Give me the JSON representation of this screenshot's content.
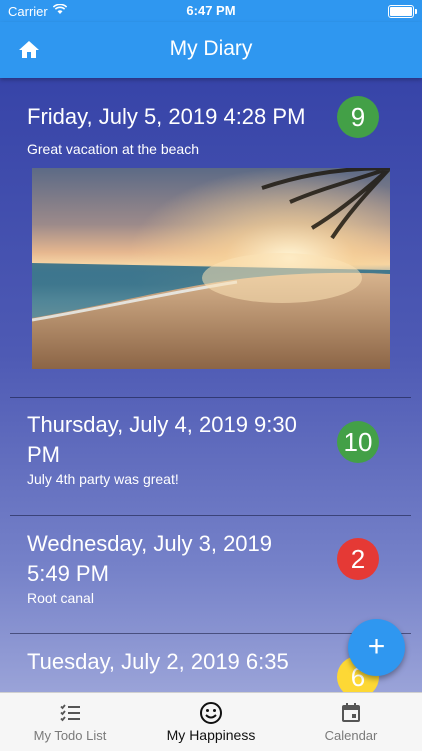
{
  "status_bar": {
    "carrier": "Carrier",
    "time": "6:47 PM"
  },
  "app_bar": {
    "title": "My Diary"
  },
  "entries": [
    {
      "date": "Friday, July 5, 2019 4:28 PM",
      "note": "Great vacation at the beach",
      "score": "9",
      "score_color": "#43a047",
      "has_photo": true
    },
    {
      "date": "Thursday, July 4, 2019 9:30 PM",
      "note": "July 4th party was great!",
      "score": "10",
      "score_color": "#43a047"
    },
    {
      "date": "Wednesday, July 3, 2019 5:49 PM",
      "note": "Root canal",
      "score": "2",
      "score_color": "#e53935"
    },
    {
      "date": "Tuesday, July 2, 2019 6:35",
      "note": "",
      "score": "6",
      "score_color": "#fdd835"
    }
  ],
  "fab": {
    "icon": "plus-icon",
    "label": "+"
  },
  "tabs": [
    {
      "label": "My Todo List",
      "icon": "checklist-icon"
    },
    {
      "label": "My Happiness",
      "icon": "smiley-icon"
    },
    {
      "label": "Calendar",
      "icon": "calendar-icon"
    }
  ],
  "colors": {
    "primary": "#2f97f0",
    "good": "#43a047",
    "bad": "#e53935",
    "neutral": "#fdd835"
  }
}
